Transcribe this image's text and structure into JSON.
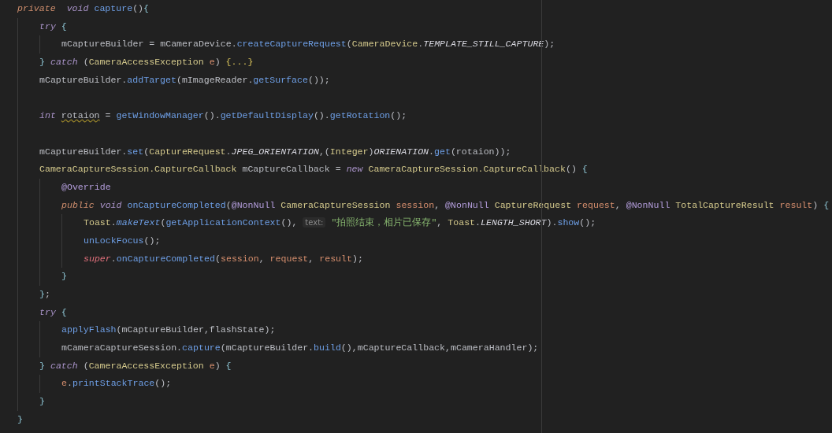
{
  "editor": {
    "lines": [
      {
        "kind": "code",
        "tokens": [
          {
            "text": "private  ",
            "kind": "modifier"
          },
          {
            "text": "void ",
            "kind": "keyword"
          },
          {
            "text": "capture",
            "kind": "method"
          },
          {
            "text": "()",
            "kind": "plain"
          },
          {
            "text": "{",
            "kind": "brace"
          }
        ],
        "children": [
          {
            "kind": "code",
            "tokens": [
              {
                "text": "try ",
                "kind": "keyword"
              },
              {
                "text": "{",
                "kind": "brace"
              }
            ],
            "children": [
              {
                "kind": "code",
                "tokens": [
                  {
                    "text": "mCaptureBuilder = mCameraDevice.",
                    "kind": "plain"
                  },
                  {
                    "text": "createCaptureRequest",
                    "kind": "method"
                  },
                  {
                    "text": "(",
                    "kind": "plain"
                  },
                  {
                    "text": "CameraDevice",
                    "kind": "class"
                  },
                  {
                    "text": ".",
                    "kind": "plain"
                  },
                  {
                    "text": "TEMPLATE_STILL_CAPTURE",
                    "kind": "constant"
                  },
                  {
                    "text": ");",
                    "kind": "plain"
                  }
                ]
              }
            ]
          },
          {
            "kind": "code",
            "tokens": [
              {
                "text": "} ",
                "kind": "brace"
              },
              {
                "text": "catch",
                "kind": "keyword"
              },
              {
                "text": " (",
                "kind": "plain"
              },
              {
                "text": "CameraAccessException ",
                "kind": "class"
              },
              {
                "text": "e",
                "kind": "param"
              },
              {
                "text": ") ",
                "kind": "plain"
              },
              {
                "text": "{...}",
                "kind": "fold"
              }
            ]
          },
          {
            "kind": "code",
            "tokens": [
              {
                "text": "mCaptureBuilder.",
                "kind": "plain"
              },
              {
                "text": "addTarget",
                "kind": "method"
              },
              {
                "text": "(mImageReader.",
                "kind": "plain"
              },
              {
                "text": "getSurface",
                "kind": "method"
              },
              {
                "text": "());",
                "kind": "plain"
              }
            ]
          },
          {
            "kind": "blank"
          },
          {
            "kind": "code",
            "tokens": [
              {
                "text": "int ",
                "kind": "keyword"
              },
              {
                "text": "rotaion",
                "kind": "warn"
              },
              {
                "text": " = ",
                "kind": "plain"
              },
              {
                "text": "getWindowManager",
                "kind": "method"
              },
              {
                "text": "().",
                "kind": "plain"
              },
              {
                "text": "getDefaultDisplay",
                "kind": "method"
              },
              {
                "text": "().",
                "kind": "plain"
              },
              {
                "text": "getRotation",
                "kind": "method"
              },
              {
                "text": "();",
                "kind": "plain"
              }
            ]
          },
          {
            "kind": "blank"
          },
          {
            "kind": "code",
            "tokens": [
              {
                "text": "mCaptureBuilder.",
                "kind": "plain"
              },
              {
                "text": "set",
                "kind": "method"
              },
              {
                "text": "(",
                "kind": "plain"
              },
              {
                "text": "CaptureRequest",
                "kind": "class"
              },
              {
                "text": ".",
                "kind": "plain"
              },
              {
                "text": "JPEG_ORIENTATION",
                "kind": "constant"
              },
              {
                "text": ",(",
                "kind": "plain"
              },
              {
                "text": "Integer",
                "kind": "class"
              },
              {
                "text": ")",
                "kind": "plain"
              },
              {
                "text": "ORIENATION",
                "kind": "constant"
              },
              {
                "text": ".",
                "kind": "plain"
              },
              {
                "text": "get",
                "kind": "method"
              },
              {
                "text": "(rotaion));",
                "kind": "plain"
              }
            ]
          },
          {
            "kind": "code",
            "tokens": [
              {
                "text": "CameraCaptureSession.CaptureCallback",
                "kind": "class"
              },
              {
                "text": " mCaptureCallback = ",
                "kind": "plain"
              },
              {
                "text": "new ",
                "kind": "keyword"
              },
              {
                "text": "CameraCaptureSession.CaptureCallback",
                "kind": "class"
              },
              {
                "text": "() ",
                "kind": "plain"
              },
              {
                "text": "{",
                "kind": "brace"
              }
            ],
            "children": [
              {
                "kind": "code",
                "tokens": [
                  {
                    "text": "@Override",
                    "kind": "annotation"
                  }
                ]
              },
              {
                "kind": "code",
                "tokens": [
                  {
                    "text": "public ",
                    "kind": "modifier"
                  },
                  {
                    "text": "void ",
                    "kind": "keyword"
                  },
                  {
                    "text": "onCaptureCompleted",
                    "kind": "method"
                  },
                  {
                    "text": "(",
                    "kind": "plain"
                  },
                  {
                    "text": "@NonNull ",
                    "kind": "annotation"
                  },
                  {
                    "text": "CameraCaptureSession ",
                    "kind": "class"
                  },
                  {
                    "text": "session",
                    "kind": "param"
                  },
                  {
                    "text": ", ",
                    "kind": "plain"
                  },
                  {
                    "text": "@NonNull ",
                    "kind": "annotation"
                  },
                  {
                    "text": "CaptureRequest ",
                    "kind": "class"
                  },
                  {
                    "text": "request",
                    "kind": "param"
                  },
                  {
                    "text": ", ",
                    "kind": "plain"
                  },
                  {
                    "text": "@NonNull ",
                    "kind": "annotation"
                  },
                  {
                    "text": "TotalCaptureResult ",
                    "kind": "class"
                  },
                  {
                    "text": "result",
                    "kind": "param"
                  },
                  {
                    "text": ") ",
                    "kind": "plain"
                  },
                  {
                    "text": "{",
                    "kind": "brace"
                  }
                ],
                "children": [
                  {
                    "kind": "code",
                    "tokens": [
                      {
                        "text": "Toast",
                        "kind": "class"
                      },
                      {
                        "text": ".",
                        "kind": "plain"
                      },
                      {
                        "text": "makeText",
                        "kind": "static-method"
                      },
                      {
                        "text": "(",
                        "kind": "plain"
                      },
                      {
                        "text": "getApplicationContext",
                        "kind": "method"
                      },
                      {
                        "text": "(), ",
                        "kind": "plain"
                      },
                      {
                        "text": "text:",
                        "kind": "hint"
                      },
                      {
                        "text": " \"拍照结束，相片已保存\"",
                        "kind": "string"
                      },
                      {
                        "text": ", ",
                        "kind": "plain"
                      },
                      {
                        "text": "Toast",
                        "kind": "class"
                      },
                      {
                        "text": ".",
                        "kind": "plain"
                      },
                      {
                        "text": "LENGTH_SHORT",
                        "kind": "constant"
                      },
                      {
                        "text": ").",
                        "kind": "plain"
                      },
                      {
                        "text": "show",
                        "kind": "method"
                      },
                      {
                        "text": "();",
                        "kind": "plain"
                      }
                    ]
                  },
                  {
                    "kind": "code",
                    "tokens": [
                      {
                        "text": "unLockFocus",
                        "kind": "method"
                      },
                      {
                        "text": "();",
                        "kind": "plain"
                      }
                    ]
                  },
                  {
                    "kind": "code",
                    "tokens": [
                      {
                        "text": "super",
                        "kind": "super"
                      },
                      {
                        "text": ".",
                        "kind": "plain"
                      },
                      {
                        "text": "onCaptureCompleted",
                        "kind": "method"
                      },
                      {
                        "text": "(",
                        "kind": "plain"
                      },
                      {
                        "text": "session",
                        "kind": "param"
                      },
                      {
                        "text": ", ",
                        "kind": "plain"
                      },
                      {
                        "text": "request",
                        "kind": "param"
                      },
                      {
                        "text": ", ",
                        "kind": "plain"
                      },
                      {
                        "text": "result",
                        "kind": "param"
                      },
                      {
                        "text": ");",
                        "kind": "plain"
                      }
                    ]
                  }
                ]
              },
              {
                "kind": "code",
                "tokens": [
                  {
                    "text": "}",
                    "kind": "brace"
                  }
                ]
              }
            ]
          },
          {
            "kind": "code",
            "tokens": [
              {
                "text": "}",
                "kind": "brace"
              },
              {
                "text": ";",
                "kind": "plain"
              }
            ]
          },
          {
            "kind": "code",
            "tokens": [
              {
                "text": "try ",
                "kind": "keyword"
              },
              {
                "text": "{",
                "kind": "brace"
              }
            ],
            "children": [
              {
                "kind": "code",
                "tokens": [
                  {
                    "text": "applyFlash",
                    "kind": "method"
                  },
                  {
                    "text": "(mCaptureBuilder,flashState);",
                    "kind": "plain"
                  }
                ]
              },
              {
                "kind": "code",
                "tokens": [
                  {
                    "text": "mCameraCaptureSession.",
                    "kind": "plain"
                  },
                  {
                    "text": "capture",
                    "kind": "method"
                  },
                  {
                    "text": "(mCaptureBuilder.",
                    "kind": "plain"
                  },
                  {
                    "text": "build",
                    "kind": "method"
                  },
                  {
                    "text": "(),mCaptureCallback,mCameraHandler);",
                    "kind": "plain"
                  }
                ]
              }
            ]
          },
          {
            "kind": "code",
            "tokens": [
              {
                "text": "} ",
                "kind": "brace"
              },
              {
                "text": "catch",
                "kind": "keyword"
              },
              {
                "text": " (",
                "kind": "plain"
              },
              {
                "text": "CameraAccessException ",
                "kind": "class"
              },
              {
                "text": "e",
                "kind": "param"
              },
              {
                "text": ") ",
                "kind": "plain"
              },
              {
                "text": "{",
                "kind": "brace"
              }
            ],
            "children": [
              {
                "kind": "code",
                "tokens": [
                  {
                    "text": "e",
                    "kind": "param"
                  },
                  {
                    "text": ".",
                    "kind": "plain"
                  },
                  {
                    "text": "printStackTrace",
                    "kind": "method"
                  },
                  {
                    "text": "();",
                    "kind": "plain"
                  }
                ]
              }
            ]
          },
          {
            "kind": "code",
            "tokens": [
              {
                "text": "}",
                "kind": "brace"
              }
            ]
          }
        ]
      },
      {
        "kind": "code",
        "tokens": [
          {
            "text": "}",
            "kind": "brace"
          }
        ]
      }
    ]
  }
}
